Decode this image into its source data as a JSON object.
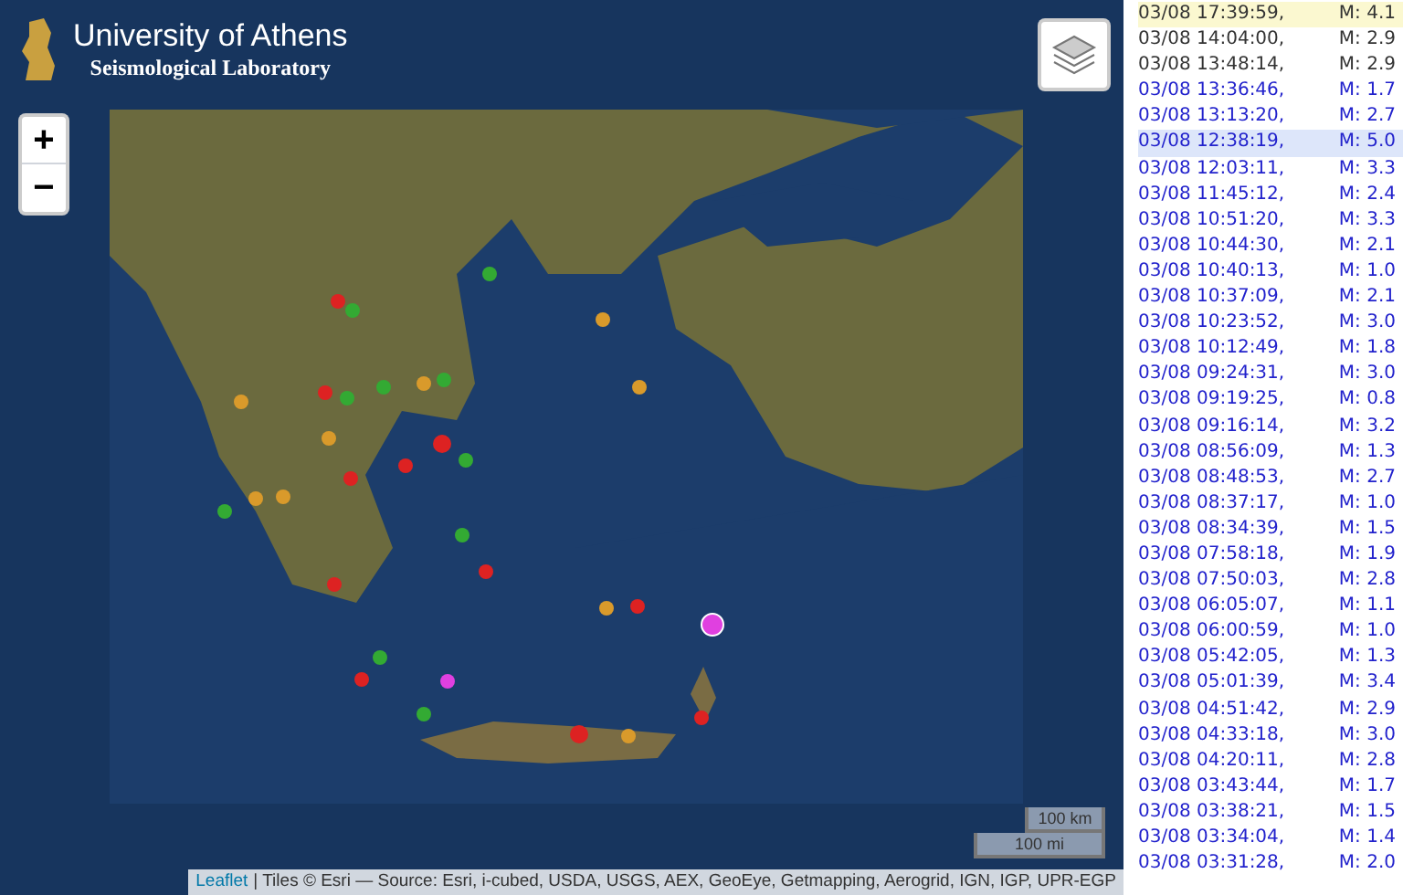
{
  "logo": {
    "title": "University of Athens",
    "subtitle": "Seismological Laboratory"
  },
  "zoom": {
    "in": "+",
    "out": "−"
  },
  "scale": {
    "km": "100 km",
    "mi": "100 mi"
  },
  "attribution": {
    "link": "Leaflet",
    "text": "| Tiles © Esri — Source: Esri, i-cubed, USDA, USGS, AEX, GeoEye, Getmapping, Aerogrid, IGN, IGP, UPR-EGP"
  },
  "events": [
    {
      "time": "03/08 17:39:59,",
      "mag": "M: 4.1",
      "kind": "latest",
      "selected": false
    },
    {
      "time": "03/08 14:04:00,",
      "mag": "M: 2.9",
      "kind": "recent",
      "selected": false
    },
    {
      "time": "03/08 13:48:14,",
      "mag": "M: 2.9",
      "kind": "recent",
      "selected": false
    },
    {
      "time": "03/08 13:36:46,",
      "mag": "M: 1.7",
      "kind": "older",
      "selected": false
    },
    {
      "time": "03/08 13:13:20,",
      "mag": "M: 2.7",
      "kind": "older",
      "selected": false
    },
    {
      "time": "03/08 12:38:19,",
      "mag": "M: 5.0",
      "kind": "older",
      "selected": true
    },
    {
      "time": "03/08 12:03:11,",
      "mag": "M: 3.3",
      "kind": "older",
      "selected": false
    },
    {
      "time": "03/08 11:45:12,",
      "mag": "M: 2.4",
      "kind": "older",
      "selected": false
    },
    {
      "time": "03/08 10:51:20,",
      "mag": "M: 3.3",
      "kind": "older",
      "selected": false
    },
    {
      "time": "03/08 10:44:30,",
      "mag": "M: 2.1",
      "kind": "older",
      "selected": false
    },
    {
      "time": "03/08 10:40:13,",
      "mag": "M: 1.0",
      "kind": "older",
      "selected": false
    },
    {
      "time": "03/08 10:37:09,",
      "mag": "M: 2.1",
      "kind": "older",
      "selected": false
    },
    {
      "time": "03/08 10:23:52,",
      "mag": "M: 3.0",
      "kind": "older",
      "selected": false
    },
    {
      "time": "03/08 10:12:49,",
      "mag": "M: 1.8",
      "kind": "older",
      "selected": false
    },
    {
      "time": "03/08 09:24:31,",
      "mag": "M: 3.0",
      "kind": "older",
      "selected": false
    },
    {
      "time": "03/08 09:19:25,",
      "mag": "M: 0.8",
      "kind": "older",
      "selected": false
    },
    {
      "time": "03/08 09:16:14,",
      "mag": "M: 3.2",
      "kind": "older",
      "selected": false
    },
    {
      "time": "03/08 08:56:09,",
      "mag": "M: 1.3",
      "kind": "older",
      "selected": false
    },
    {
      "time": "03/08 08:48:53,",
      "mag": "M: 2.7",
      "kind": "older",
      "selected": false
    },
    {
      "time": "03/08 08:37:17,",
      "mag": "M: 1.0",
      "kind": "older",
      "selected": false
    },
    {
      "time": "03/08 08:34:39,",
      "mag": "M: 1.5",
      "kind": "older",
      "selected": false
    },
    {
      "time": "03/08 07:58:18,",
      "mag": "M: 1.9",
      "kind": "older",
      "selected": false
    },
    {
      "time": "03/08 07:50:03,",
      "mag": "M: 2.8",
      "kind": "older",
      "selected": false
    },
    {
      "time": "03/08 06:05:07,",
      "mag": "M: 1.1",
      "kind": "older",
      "selected": false
    },
    {
      "time": "03/08 06:00:59,",
      "mag": "M: 1.0",
      "kind": "older",
      "selected": false
    },
    {
      "time": "03/08 05:42:05,",
      "mag": "M: 1.3",
      "kind": "older",
      "selected": false
    },
    {
      "time": "03/08 05:01:39,",
      "mag": "M: 3.4",
      "kind": "older",
      "selected": false
    },
    {
      "time": "03/08 04:51:42,",
      "mag": "M: 2.9",
      "kind": "older",
      "selected": false
    },
    {
      "time": "03/08 04:33:18,",
      "mag": "M: 3.0",
      "kind": "older",
      "selected": false
    },
    {
      "time": "03/08 04:20:11,",
      "mag": "M: 2.8",
      "kind": "older",
      "selected": false
    },
    {
      "time": "03/08 03:43:44,",
      "mag": "M: 1.7",
      "kind": "older",
      "selected": false
    },
    {
      "time": "03/08 03:38:21,",
      "mag": "M: 1.5",
      "kind": "older",
      "selected": false
    },
    {
      "time": "03/08 03:34:04,",
      "mag": "M: 1.4",
      "kind": "older",
      "selected": false
    },
    {
      "time": "03/08 03:31:28,",
      "mag": "M: 2.0",
      "kind": "older",
      "selected": false
    }
  ]
}
